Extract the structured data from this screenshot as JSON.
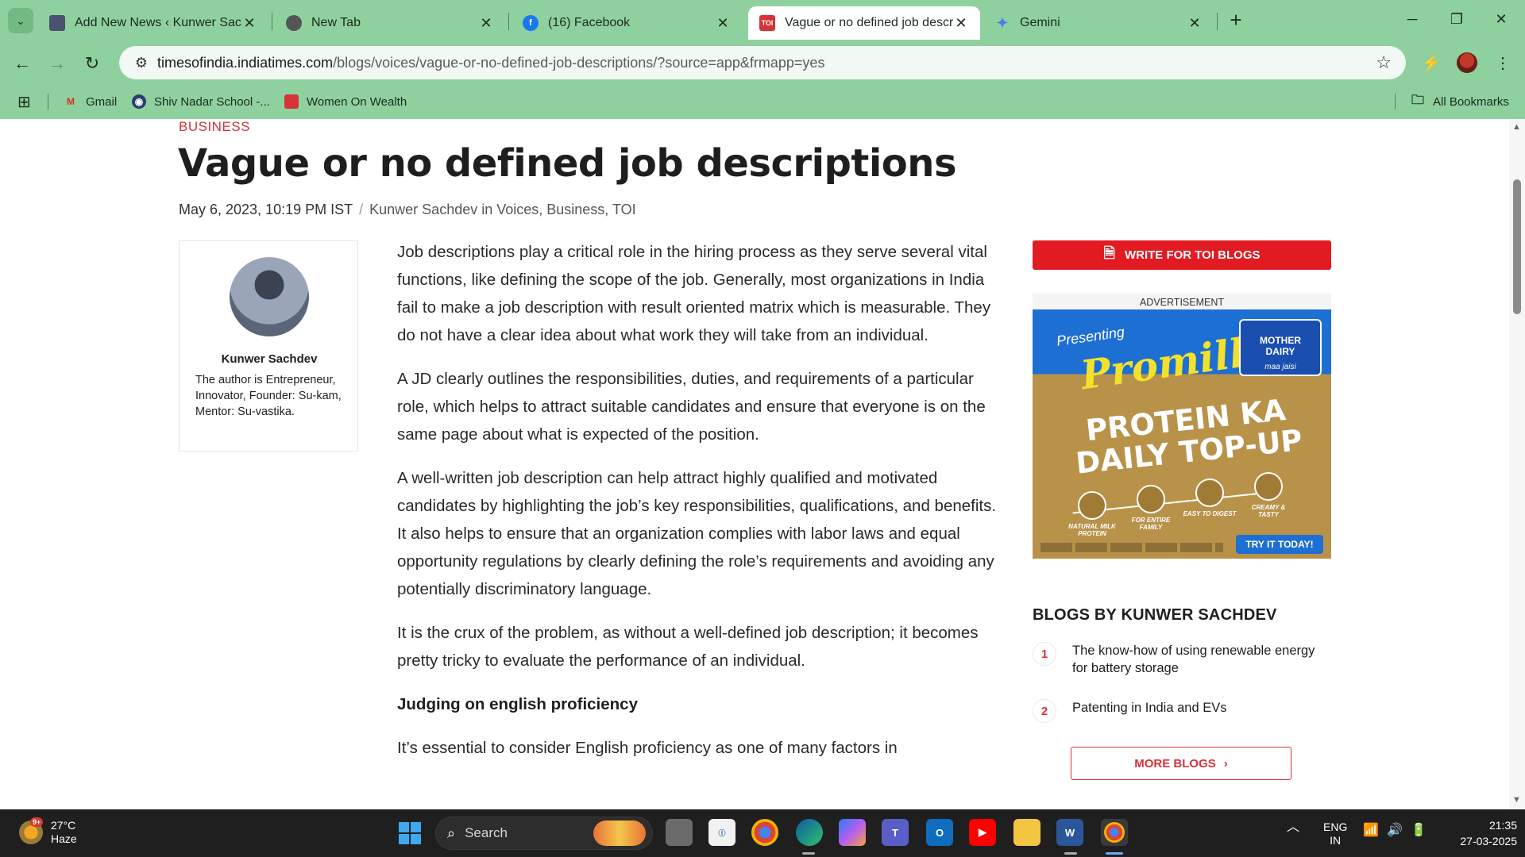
{
  "browser": {
    "tabs": [
      {
        "title": "Add New News ‹ Kunwer Sachdev",
        "favicon": "site-thumbnail-icon",
        "active": false
      },
      {
        "title": "New Tab",
        "favicon": "chrome-icon",
        "active": false
      },
      {
        "title": "(16) Facebook",
        "favicon": "facebook-icon",
        "active": false
      },
      {
        "title": "Vague or no defined job descriptions",
        "favicon": "toi-icon",
        "favicon_text": "TOI",
        "active": true
      },
      {
        "title": "Gemini",
        "favicon": "gemini-icon",
        "active": false
      }
    ],
    "url_domain": "timesofindia.indiatimes.com",
    "url_path": "/blogs/voices/vague-or-no-defined-job-descriptions/?source=app&frmapp=yes",
    "bookmarks": [
      {
        "label": "Gmail",
        "icon": "gmail-icon"
      },
      {
        "label": "Shiv Nadar School -...",
        "icon": "school-icon"
      },
      {
        "label": "Women On Wealth",
        "icon": "wow-icon"
      }
    ],
    "all_bookmarks": "All Bookmarks",
    "theme_color": "#8fd19e"
  },
  "article": {
    "category": "BUSINESS",
    "title": "Vague or no defined job descriptions",
    "date": "May 6, 2023, 10:19 PM IST",
    "byline": "Kunwer Sachdev in Voices, Business, TOI",
    "author": {
      "name": "Kunwer Sachdev",
      "bio": "The author is Entrepreneur, Innovator, Founder: Su-kam, Mentor: Su-vastika."
    },
    "paragraphs": [
      "Job descriptions play a critical role in the hiring process as they serve several vital functions, like defining the scope of the job. Generally, most organizations in India fail to make a job description with result oriented matrix which is measurable. They do not have a clear idea about what work they will take from an individual.",
      "A JD clearly outlines the responsibilities, duties, and requirements of a particular role, which helps to attract suitable candidates and ensure that everyone is on the same page about what is expected of the position.",
      "A well-written job description can help attract highly qualified and motivated candidates by highlighting the job’s key responsibilities, qualifications, and benefits. It also helps to ensure that an organization complies with labor laws and equal opportunity regulations by clearly defining the role’s requirements and avoiding any potentially discriminatory language.",
      "It is the crux of the problem, as without a well-defined job description; it becomes pretty tricky to evaluate the performance of an individual."
    ],
    "subheading": "Judging on english proficiency",
    "cut_paragraph": "It’s essential to consider English proficiency as one of many factors in"
  },
  "sidebar": {
    "write_button": "WRITE FOR TOI BLOGS",
    "ad_label": "ADVERTISEMENT",
    "ad": {
      "presenting": "Presenting",
      "brand": "Promilk",
      "logo_line1": "MOTHER",
      "logo_line2": "DAIRY",
      "logo_tag": "maa jaisi",
      "headline": "PROTEIN KA DAILY TOP-UP",
      "features": [
        "NATURAL MILK PROTEIN",
        "FOR ENTIRE FAMILY",
        "EASY TO DIGEST",
        "CREAMY & TASTY"
      ],
      "cta": "TRY IT TODAY!"
    },
    "blogs_title": "BLOGS BY KUNWER SACHDEV",
    "blogs": [
      {
        "num": "1",
        "title": "The know-how of using renewable energy for battery storage"
      },
      {
        "num": "2",
        "title": "Patenting in India and EVs"
      }
    ],
    "more_blogs": "MORE BLOGS",
    "accent": "#e21b22"
  },
  "taskbar": {
    "weather_temp": "27°C",
    "weather_desc": "Haze",
    "weather_badge": "9+",
    "search_placeholder": "Search",
    "language_top": "ENG",
    "language_bottom": "IN",
    "time": "21:35",
    "date": "27-03-2025"
  }
}
